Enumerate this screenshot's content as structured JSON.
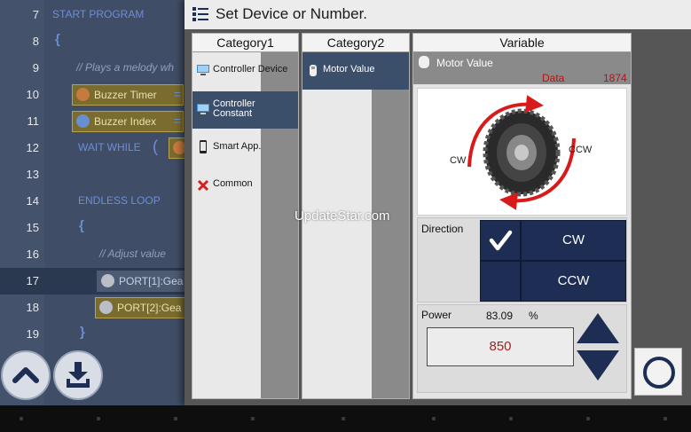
{
  "editor": {
    "lines": [
      {
        "num": "7"
      },
      {
        "num": "8"
      },
      {
        "num": "9"
      },
      {
        "num": "10"
      },
      {
        "num": "11"
      },
      {
        "num": "12"
      },
      {
        "num": "13"
      },
      {
        "num": "14"
      },
      {
        "num": "15"
      },
      {
        "num": "16"
      },
      {
        "num": "17"
      },
      {
        "num": "18"
      },
      {
        "num": "19"
      }
    ],
    "start_program": "START PROGRAM",
    "brace_open": "{",
    "comment_melody": "//    Plays a melody wh",
    "buzzer_timer": "Buzzer Timer",
    "buzzer_index": "Buzzer Index",
    "equals": "=",
    "wait_while": "WAIT WHILE",
    "paren_open": "(",
    "endless_loop": "ENDLESS LOOP",
    "brace_open_2": "{",
    "comment_adjust": "//    Adjust value",
    "port1": "PORT[1]:Gea",
    "port2": "PORT[2]:Gea",
    "brace_close": "}"
  },
  "dialog": {
    "title": "Set Device or Number.",
    "category1": {
      "header": "Category1",
      "items": [
        {
          "label": "Controller Device",
          "icon": "monitor-icon"
        },
        {
          "label": "Controller\nConstant",
          "icon": "monitor-icon"
        },
        {
          "label": "Smart App.",
          "icon": "smartphone-icon"
        },
        {
          "label": "Common",
          "icon": "x-icon"
        }
      ]
    },
    "category2": {
      "header": "Category2",
      "items": [
        {
          "label": "Motor Value",
          "icon": "motor-icon"
        }
      ]
    },
    "variable": {
      "header": "Variable",
      "name": "Motor Value",
      "data_label": "Data",
      "data_value": "1874",
      "cw_label": "CW",
      "ccw_label": "CCW",
      "direction_label": "Direction",
      "dir_cw": "CW",
      "dir_ccw": "CCW",
      "power_label": "Power",
      "power_percent": "83.09",
      "power_unit": "%",
      "power_value": "850"
    }
  },
  "watermark": "UpdateStar.com",
  "colors": {
    "accent_navy": "#1d2d53",
    "selection": "#3b4f6b",
    "arrow_red": "#d81a1a",
    "data_red": "#b01515"
  }
}
